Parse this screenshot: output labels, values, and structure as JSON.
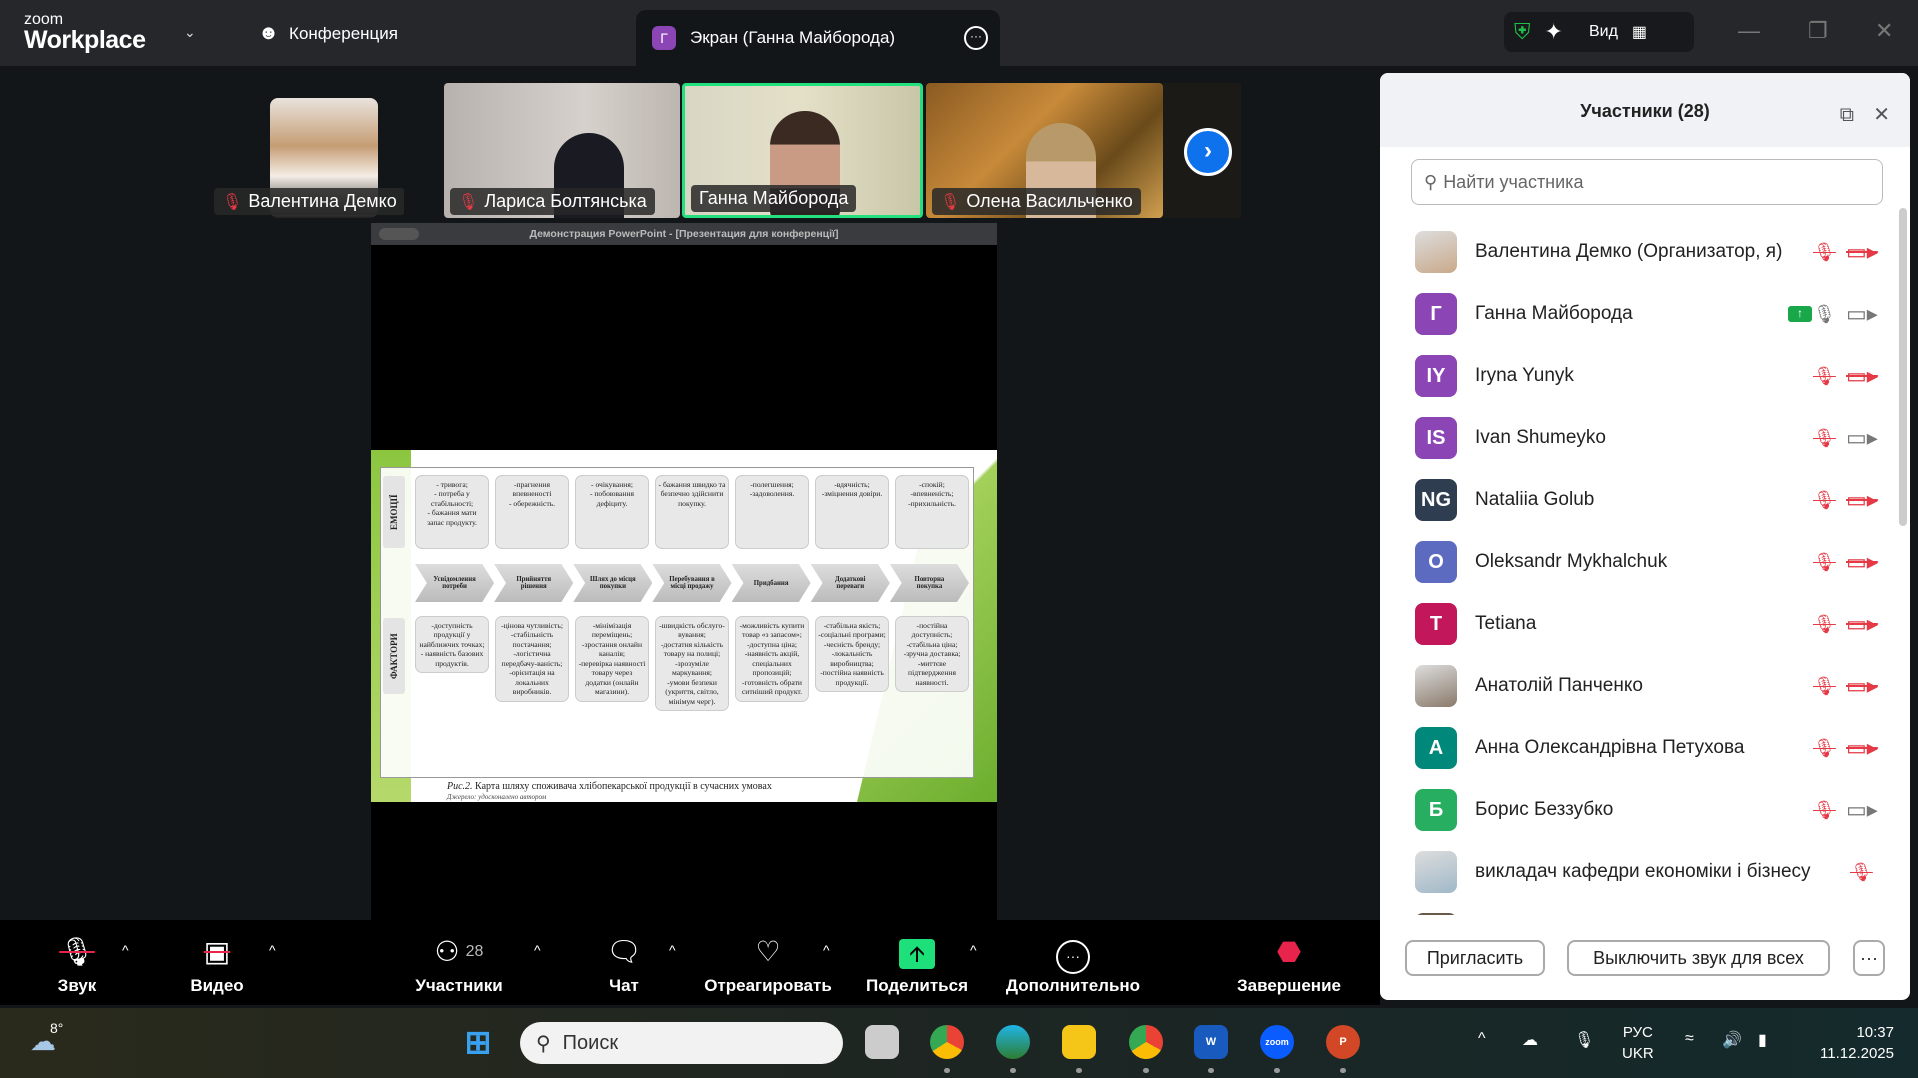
{
  "app": {
    "logo_small": "zoom",
    "logo_big": "Workplace",
    "conference_label": "Конференция",
    "screen_tab": "Экран (Ганна Майборода)",
    "screen_tab_avatar": "Г",
    "view_label": "Вид"
  },
  "thumbnails": [
    {
      "name": "Валентина Демко",
      "muted": true
    },
    {
      "name": "Лариса Болтянська",
      "muted": true
    },
    {
      "name": "Ганна Майборода",
      "muted": false,
      "active_speaker": true
    },
    {
      "name": "Олена Васильченко",
      "muted": true
    }
  ],
  "share": {
    "title": "Демонстрация PowerPoint - [Презентация для конференції]",
    "slide": {
      "row_labels": [
        "ЕМОЦІЇ",
        "ФАКТОРИ"
      ],
      "emotions": [
        "- тривога;\n- потреба у стабільності;\n- бажання мати запас продукту.",
        "-прагнення впевненості\n- обережність.",
        "- очікування;\n- побоювання дефіциту.",
        "- бажання швидко та безпечно здійснити покупку.",
        "-полегшення;\n-задоволення.",
        "-вдячність;\n-зміцнення довіри.",
        "-спокій;\n-впевненість;\n-прихильність."
      ],
      "stages": [
        "Усвідомлення потреби",
        "Прийняття рішення",
        "Шлях до місця покупки",
        "Перебування в місці продажу",
        "Придбання",
        "Додаткові переваги",
        "Повторна покупка"
      ],
      "factors": [
        "-доступність продукції у найближчих точках;\n- наявність базових продуктів.",
        "-цінова чутливість;\n-стабільність постачання;\n-логістична передбачу-ваність;\n-орієнтація на локальних виробників.",
        "-мінімізація переміщень;\n-зростання онлайн каналів;\n-перевірка наявності товару через додатки (онлайн магазини).",
        "-швидкість обслуго-вування;\n-достатня кількість товару на полиці;\n-зрозуміле маркування;\n-умови безпеки (укриття, світло, мінімум черг).",
        "-можливість купити товар «з запасом»;\n-доступна ціна;\n-наявність акцій, спеціальних пропозицій;\n-готовність обрати ситніший продукт.",
        "-стабільна якість;\n-соціальні програми;\n-чесність бренду;\n-локальність виробництва;\n-постійна наявність продукції.",
        "-постійна доступність;\n-стабільна ціна;\n-зручна доставка;\n-миттєве підтвердження наявності."
      ],
      "caption_prefix": "Рис.2.",
      "caption": " Карта шляху споживача хлібопекарської продукції в сучасних умовах",
      "source": "Джерело: удосконалено автором"
    }
  },
  "panel": {
    "title": "Участники (28)",
    "search_placeholder": "Найти участника",
    "participants": [
      {
        "name": "Валентина Демко (Организатор, я)",
        "initials": "",
        "color": "#c9a98a",
        "mic": "muted",
        "cam": "off"
      },
      {
        "name": "Ганна Майборода",
        "initials": "Г",
        "color": "#8b45b4",
        "mic": "on",
        "cam": "on",
        "sharing": true
      },
      {
        "name": "Iryna Yunyk",
        "initials": "IY",
        "color": "#8b45b4",
        "mic": "muted",
        "cam": "off"
      },
      {
        "name": "Ivan Shumeyko",
        "initials": "IS",
        "color": "#8b45b4",
        "mic": "muted",
        "cam": "on"
      },
      {
        "name": "Nataliia Golub",
        "initials": "NG",
        "color": "#2e3e50",
        "mic": "muted",
        "cam": "off"
      },
      {
        "name": "Oleksandr Mykhalchuk",
        "initials": "O",
        "color": "#5c6bc0",
        "mic": "muted",
        "cam": "off"
      },
      {
        "name": "Tetiana",
        "initials": "T",
        "color": "#c2185b",
        "mic": "muted",
        "cam": "off"
      },
      {
        "name": "Анатолій Панченко",
        "initials": "",
        "color": "#8a7a6a",
        "mic": "muted",
        "cam": "off"
      },
      {
        "name": "Анна Олександрівна Петухова",
        "initials": "A",
        "color": "#00897b",
        "mic": "muted",
        "cam": "off"
      },
      {
        "name": "Борис Беззубко",
        "initials": "Б",
        "color": "#27ae60",
        "mic": "muted",
        "cam": "on"
      },
      {
        "name": "викладач кафедри економіки і бізнесу",
        "initials": "",
        "color": "#9fb8c8",
        "mic": "muted",
        "cam": "none"
      }
    ],
    "invite_label": "Пригласить",
    "mute_all_label": "Выключить звук для всех"
  },
  "toolbar": {
    "items": [
      {
        "label": "Звук"
      },
      {
        "label": "Видео"
      },
      {
        "label": "Участники",
        "count": "28"
      },
      {
        "label": "Чат"
      },
      {
        "label": "Отреагировать"
      },
      {
        "label": "Поделиться"
      },
      {
        "label": "Дополнительно"
      },
      {
        "label": "Завершение"
      }
    ],
    "colors": {
      "share": "#1de07a",
      "end": "#e8244c",
      "muted": "#e53945"
    }
  },
  "taskbar": {
    "weather": "8°",
    "search_placeholder": "Поиск",
    "lang_top": "РУС",
    "lang_bottom": "UKR",
    "time": "10:37",
    "date": "11.12.2025",
    "zoom_app": "zoom"
  }
}
